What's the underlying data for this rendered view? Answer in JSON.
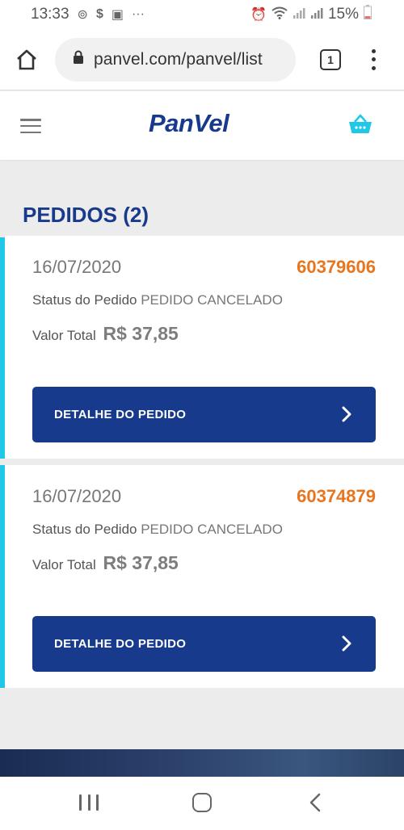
{
  "status_bar": {
    "time": "13:33",
    "battery": "15%"
  },
  "browser": {
    "url": "panvel.com/panvel/list",
    "tab_count": "1"
  },
  "site": {
    "logo": "PanVel"
  },
  "page": {
    "title": "PEDIDOS (2)"
  },
  "orders": [
    {
      "date": "16/07/2020",
      "number": "60379606",
      "status_label": "Status do Pedido",
      "status_value": "PEDIDO CANCELADO",
      "total_label": "Valor Total",
      "total_value": "R$ 37,85",
      "button_label": "DETALHE DO PEDIDO"
    },
    {
      "date": "16/07/2020",
      "number": "60374879",
      "status_label": "Status do Pedido",
      "status_value": "PEDIDO CANCELADO",
      "total_label": "Valor Total",
      "total_value": "R$ 37,85",
      "button_label": "DETALHE DO PEDIDO"
    }
  ],
  "colors": {
    "brand_blue": "#173a8c",
    "accent_orange": "#e8761e",
    "accent_cyan": "#1ec8e6"
  },
  "icons": [
    "home-icon",
    "lock-icon",
    "tab-switcher-icon",
    "more-vert-icon",
    "hamburger-menu-icon",
    "shopping-basket-icon",
    "chevron-right-icon",
    "nav-recents-icon",
    "nav-home-icon",
    "nav-back-icon"
  ]
}
